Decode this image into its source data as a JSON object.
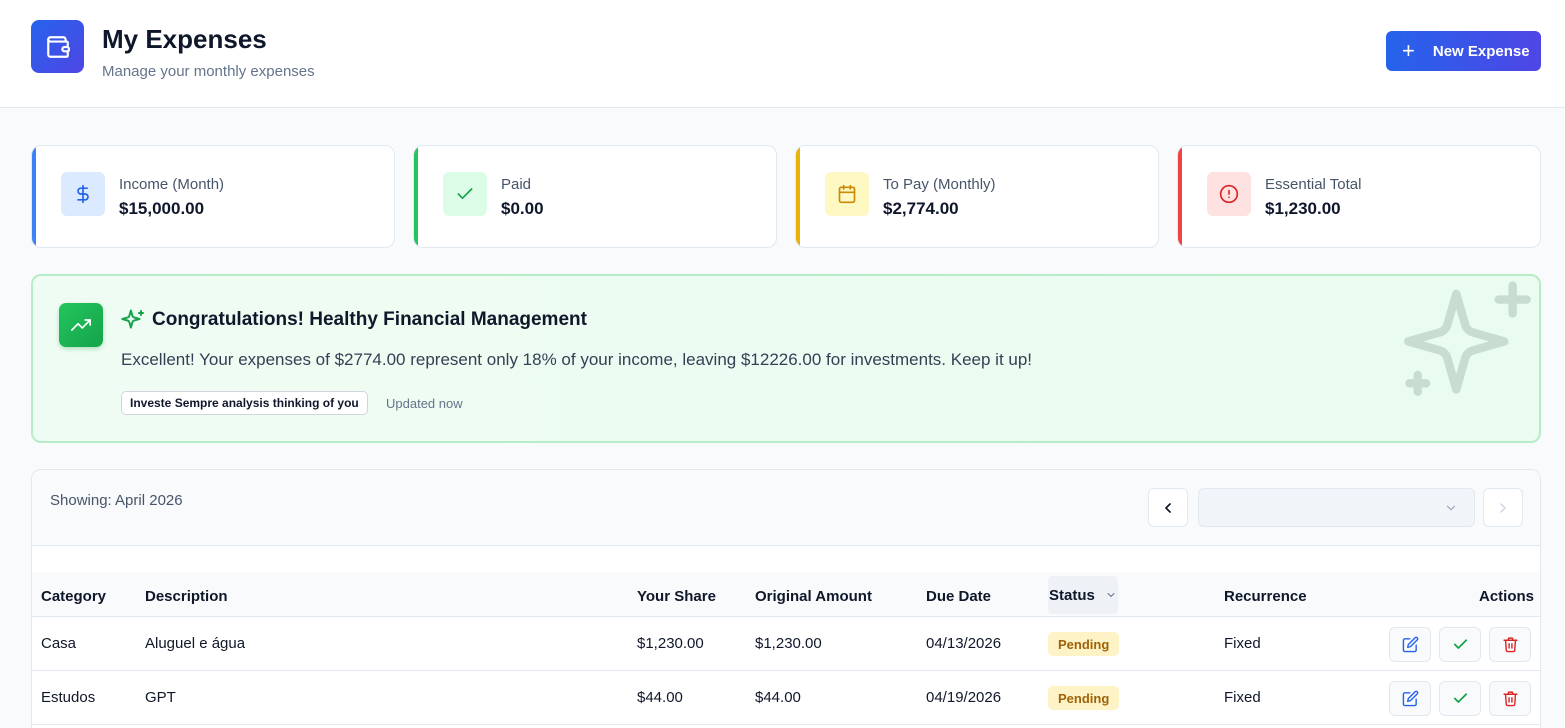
{
  "header": {
    "title": "My Expenses",
    "subtitle": "Manage your monthly expenses",
    "new_button_label": "New Expense"
  },
  "stats": [
    {
      "label": "Income (Month)",
      "value": "$15,000.00",
      "icon": "dollar-icon",
      "color": "#3b82f6"
    },
    {
      "label": "Paid",
      "value": "$0.00",
      "icon": "check-icon",
      "color": "#22c55e"
    },
    {
      "label": "To Pay (Monthly)",
      "value": "$2,774.00",
      "icon": "calendar-icon",
      "color": "#eab308"
    },
    {
      "label": "Essential Total",
      "value": "$1,230.00",
      "icon": "alert-circle-icon",
      "color": "#ef4444"
    }
  ],
  "insight": {
    "title": "Congratulations! Healthy Financial Management",
    "message": "Excellent! Your expenses of $2774.00 represent only 18% of your income, leaving $12226.00 for investments. Keep it up!",
    "badge": "Investe Sempre analysis thinking of you",
    "updated": "Updated now"
  },
  "table": {
    "showing": "Showing: April 2026",
    "month_select_value": "",
    "columns": {
      "category": "Category",
      "description": "Description",
      "your_share": "Your Share",
      "original_amount": "Original Amount",
      "due_date": "Due Date",
      "status": "Status",
      "recurrence": "Recurrence",
      "actions": "Actions"
    },
    "rows": [
      {
        "category": "Casa",
        "description": "Aluguel e água",
        "your_share": "$1,230.00",
        "original_amount": "$1,230.00",
        "due_date": "04/13/2026",
        "status": "Pending",
        "recurrence": "Fixed"
      },
      {
        "category": "Estudos",
        "description": "GPT",
        "your_share": "$44.00",
        "original_amount": "$44.00",
        "due_date": "04/19/2026",
        "status": "Pending",
        "recurrence": "Fixed"
      }
    ]
  },
  "colors": {
    "primary": "#2563eb",
    "primary_end": "#4f46e5",
    "success": "#16a34a",
    "danger": "#dc2626",
    "warning_bg": "#fef3c7"
  }
}
